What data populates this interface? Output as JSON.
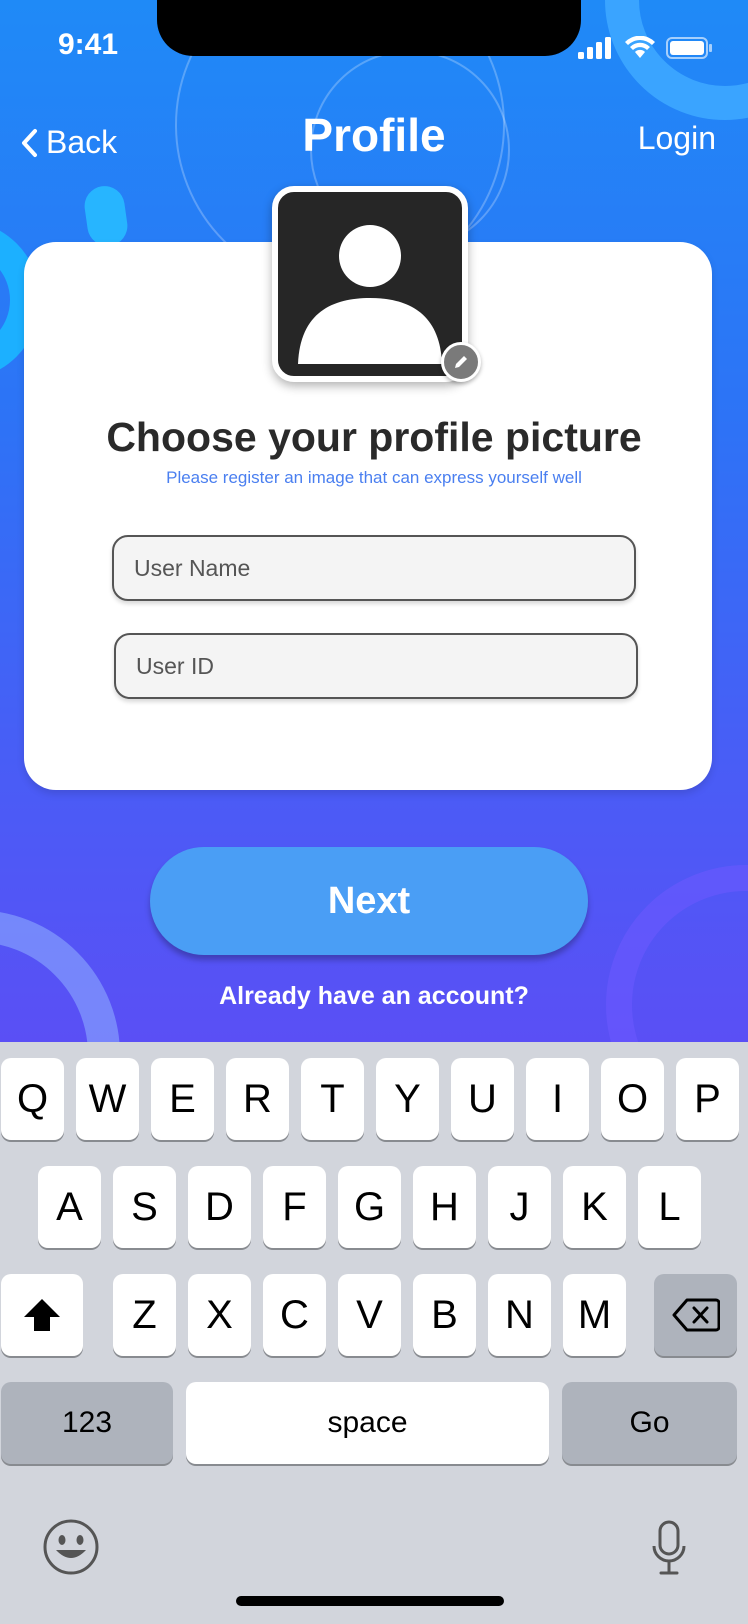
{
  "status_bar": {
    "time": "9:41"
  },
  "nav": {
    "back_label": "Back",
    "title": "Profile",
    "login_label": "Login"
  },
  "card": {
    "title": "Choose your profile picture",
    "subtitle": "Please register an image that can express yourself well",
    "username_placeholder": "User Name",
    "userid_placeholder": "User ID"
  },
  "actions": {
    "next_label": "Next",
    "already_label": "Already have an account?"
  },
  "keyboard": {
    "row1": [
      "Q",
      "W",
      "E",
      "R",
      "T",
      "Y",
      "U",
      "I",
      "O",
      "P"
    ],
    "row2": [
      "A",
      "S",
      "D",
      "F",
      "G",
      "H",
      "J",
      "K",
      "L"
    ],
    "row3": [
      "Z",
      "X",
      "C",
      "V",
      "B",
      "N",
      "M"
    ],
    "numbers_label": "123",
    "space_label": "space",
    "go_label": "Go"
  },
  "icons": {
    "back": "chevron-left-icon",
    "edit": "pencil-icon",
    "shift": "shift-icon",
    "delete": "backspace-icon",
    "emoji": "emoji-icon",
    "mic": "microphone-icon"
  },
  "colors": {
    "accent": "#1f8af7",
    "button": "#4a9ef5",
    "subtitle": "#4a7ff0"
  }
}
